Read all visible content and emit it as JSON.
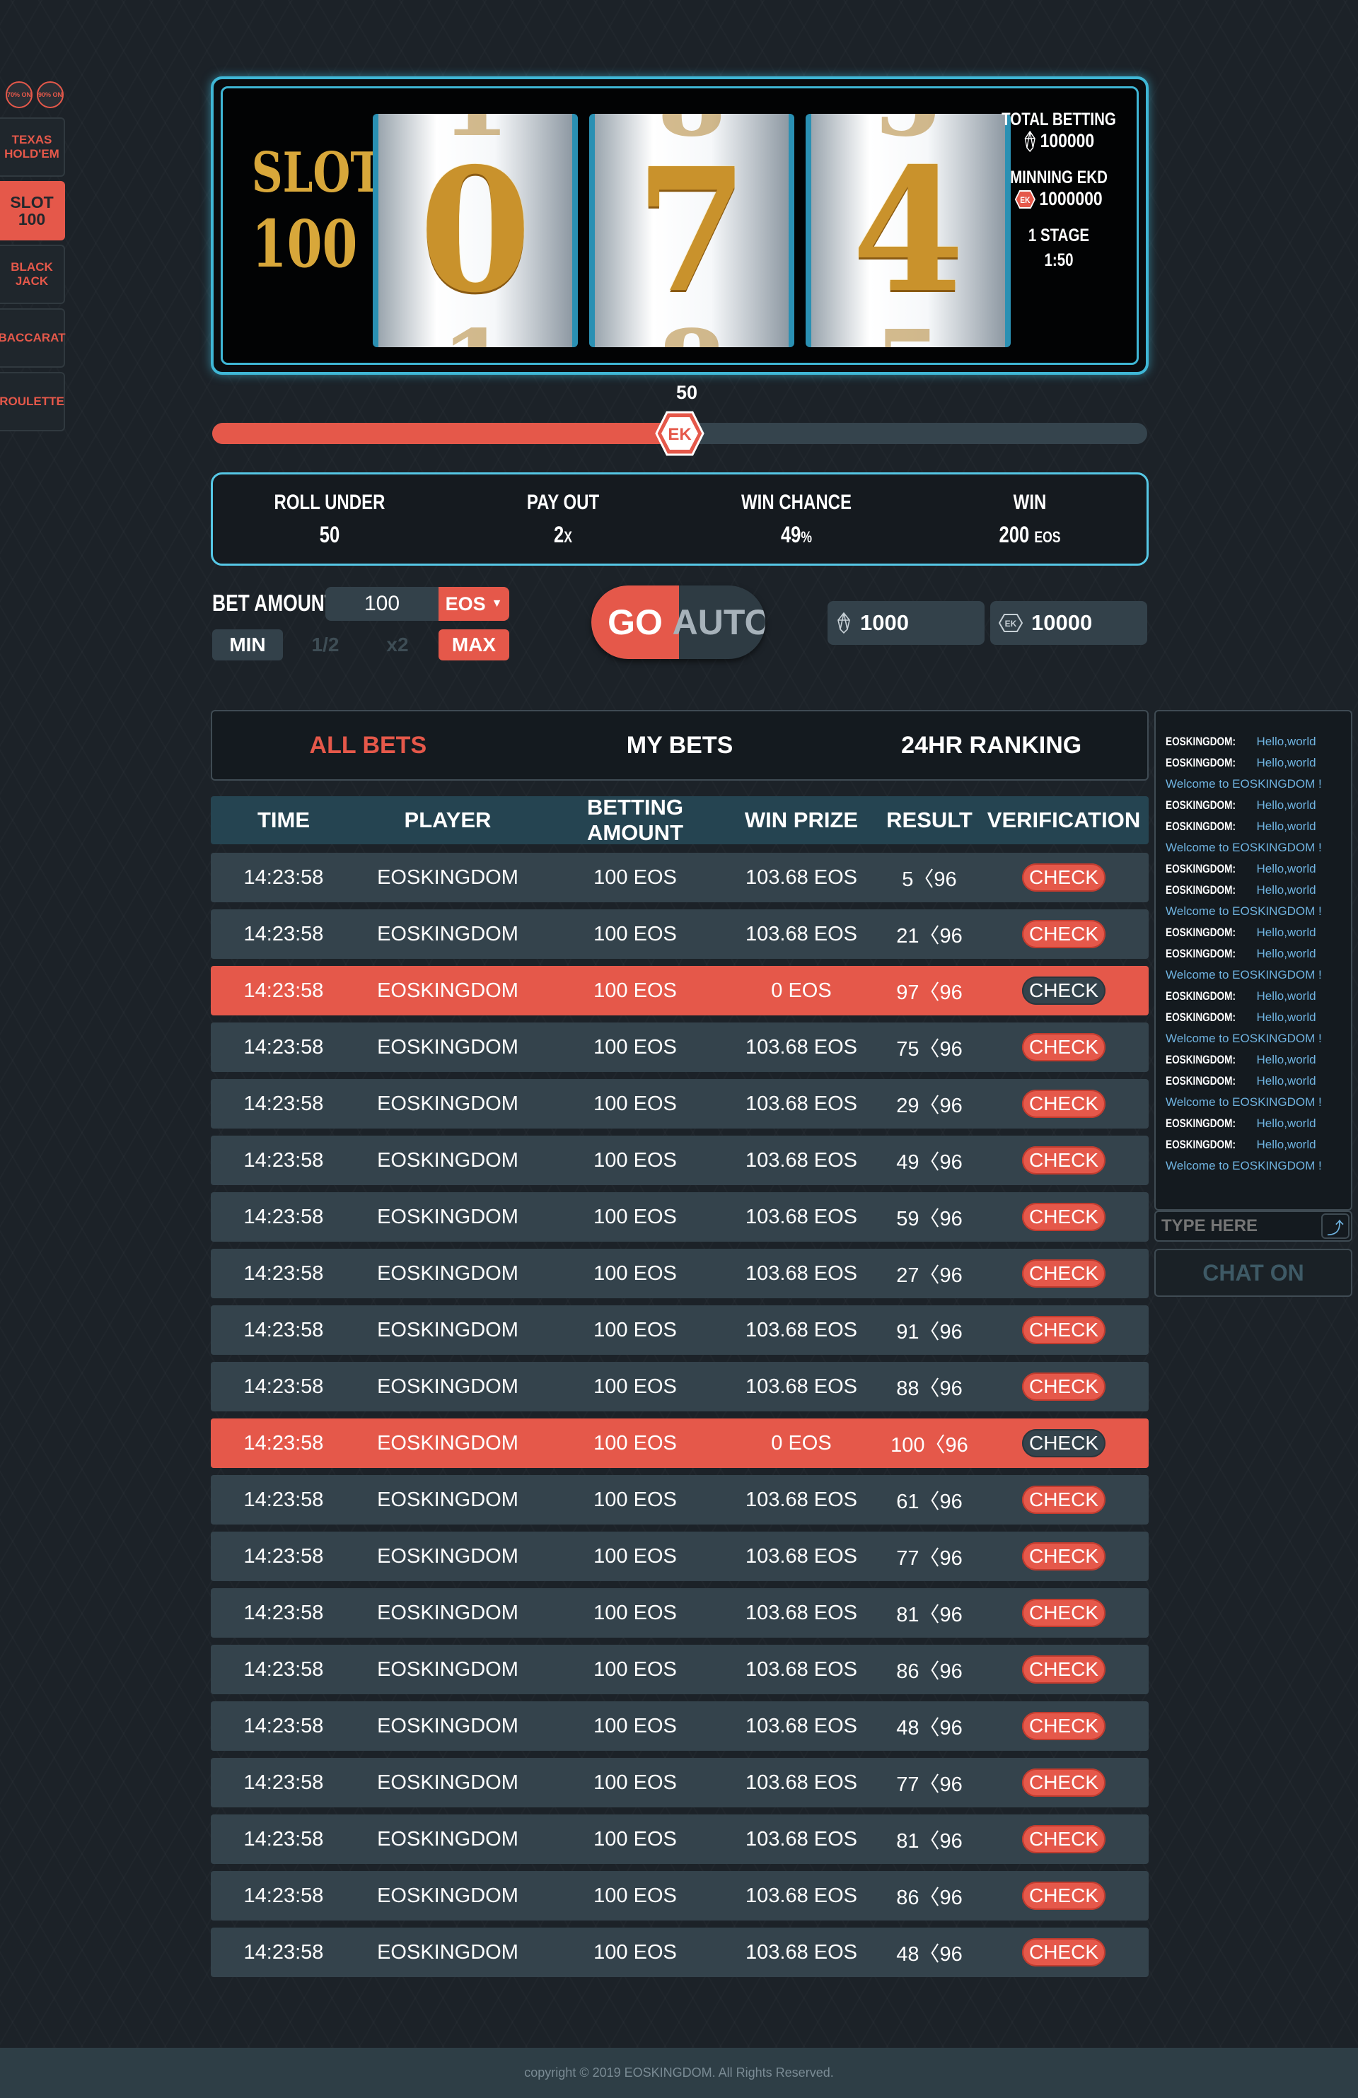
{
  "colors": {
    "accent": "#e5584a",
    "cyan": "#3fb7d6",
    "gold": "#c9922c",
    "bg": "#1c2228",
    "row": "#34434c",
    "header": "#254451"
  },
  "sidebar": {
    "toggles": [
      "70% ON",
      "90% ON"
    ],
    "items": [
      {
        "label": "TEXAS HOLD'EM",
        "active": false
      },
      {
        "label": "SLOT 100",
        "active": true
      },
      {
        "label": "BLACK JACK",
        "active": false
      },
      {
        "label": "BACCARAT",
        "active": false
      },
      {
        "label": "ROULETTE",
        "active": false
      }
    ]
  },
  "slot": {
    "title_line1": "SLOT",
    "title_line2": "100",
    "reels": [
      {
        "digit": "0",
        "above": "1",
        "below": "1"
      },
      {
        "digit": "7",
        "above": "8",
        "below": "8"
      },
      {
        "digit": "4",
        "above": "5",
        "below": "5"
      }
    ],
    "total_betting_label": "TOTAL BETTING",
    "total_betting_value": "100000",
    "mining_label": "MINNING EKD",
    "mining_value": "1000000",
    "stage_label": "1 STAGE",
    "stage_time": "1:50"
  },
  "slider": {
    "value": "50",
    "fraction": 0.5
  },
  "stats": {
    "roll_under_label": "ROLL UNDER",
    "roll_under_value": "50",
    "payout_label": "PAY OUT",
    "payout_value": "2",
    "payout_unit": "X",
    "win_chance_label": "WIN CHANCE",
    "win_chance_value": "49",
    "win_chance_unit": "%",
    "win_label": "WIN",
    "win_value": "200",
    "win_unit": "EOS"
  },
  "bet": {
    "label": "BET AMOUNT",
    "amount": "100",
    "currency": "EOS",
    "min": "MIN",
    "half": "1/2",
    "double": "x2",
    "max": "MAX",
    "go": "GO",
    "auto": "AUTO",
    "eos_balance": "1000",
    "ekd_balance": "10000"
  },
  "tabs": {
    "all_bets": "ALL BETS",
    "my_bets": "MY BETS",
    "ranking": "24HR RANKING"
  },
  "table": {
    "headers": [
      "TIME",
      "PLAYER",
      "BETTING AMOUNT",
      "WIN PRIZE",
      "RESULT",
      "VERIFICATION"
    ],
    "rows": [
      {
        "time": "14:23:58",
        "player": "EOSKINGDOM",
        "amount": "100 EOS",
        "prize": "103.68 EOS",
        "result": "5〈96",
        "verify": "CHECK",
        "lost": false
      },
      {
        "time": "14:23:58",
        "player": "EOSKINGDOM",
        "amount": "100 EOS",
        "prize": "103.68 EOS",
        "result": "21〈96",
        "verify": "CHECK",
        "lost": false
      },
      {
        "time": "14:23:58",
        "player": "EOSKINGDOM",
        "amount": "100 EOS",
        "prize": "0 EOS",
        "result": "97〈96",
        "verify": "CHECK",
        "lost": true
      },
      {
        "time": "14:23:58",
        "player": "EOSKINGDOM",
        "amount": "100 EOS",
        "prize": "103.68 EOS",
        "result": "75〈96",
        "verify": "CHECK",
        "lost": false
      },
      {
        "time": "14:23:58",
        "player": "EOSKINGDOM",
        "amount": "100 EOS",
        "prize": "103.68 EOS",
        "result": "29〈96",
        "verify": "CHECK",
        "lost": false
      },
      {
        "time": "14:23:58",
        "player": "EOSKINGDOM",
        "amount": "100 EOS",
        "prize": "103.68 EOS",
        "result": "49〈96",
        "verify": "CHECK",
        "lost": false
      },
      {
        "time": "14:23:58",
        "player": "EOSKINGDOM",
        "amount": "100 EOS",
        "prize": "103.68 EOS",
        "result": "59〈96",
        "verify": "CHECK",
        "lost": false
      },
      {
        "time": "14:23:58",
        "player": "EOSKINGDOM",
        "amount": "100 EOS",
        "prize": "103.68 EOS",
        "result": "27〈96",
        "verify": "CHECK",
        "lost": false
      },
      {
        "time": "14:23:58",
        "player": "EOSKINGDOM",
        "amount": "100 EOS",
        "prize": "103.68 EOS",
        "result": "91〈96",
        "verify": "CHECK",
        "lost": false
      },
      {
        "time": "14:23:58",
        "player": "EOSKINGDOM",
        "amount": "100 EOS",
        "prize": "103.68 EOS",
        "result": "88〈96",
        "verify": "CHECK",
        "lost": false
      },
      {
        "time": "14:23:58",
        "player": "EOSKINGDOM",
        "amount": "100 EOS",
        "prize": "0 EOS",
        "result": "100〈96",
        "verify": "CHECK",
        "lost": true
      },
      {
        "time": "14:23:58",
        "player": "EOSKINGDOM",
        "amount": "100 EOS",
        "prize": "103.68 EOS",
        "result": "61〈96",
        "verify": "CHECK",
        "lost": false
      },
      {
        "time": "14:23:58",
        "player": "EOSKINGDOM",
        "amount": "100 EOS",
        "prize": "103.68 EOS",
        "result": "77〈96",
        "verify": "CHECK",
        "lost": false
      },
      {
        "time": "14:23:58",
        "player": "EOSKINGDOM",
        "amount": "100 EOS",
        "prize": "103.68 EOS",
        "result": "81〈96",
        "verify": "CHECK",
        "lost": false
      },
      {
        "time": "14:23:58",
        "player": "EOSKINGDOM",
        "amount": "100 EOS",
        "prize": "103.68 EOS",
        "result": "86〈96",
        "verify": "CHECK",
        "lost": false
      },
      {
        "time": "14:23:58",
        "player": "EOSKINGDOM",
        "amount": "100 EOS",
        "prize": "103.68 EOS",
        "result": "48〈96",
        "verify": "CHECK",
        "lost": false
      },
      {
        "time": "14:23:58",
        "player": "EOSKINGDOM",
        "amount": "100 EOS",
        "prize": "103.68 EOS",
        "result": "77〈96",
        "verify": "CHECK",
        "lost": false
      },
      {
        "time": "14:23:58",
        "player": "EOSKINGDOM",
        "amount": "100 EOS",
        "prize": "103.68 EOS",
        "result": "81〈96",
        "verify": "CHECK",
        "lost": false
      },
      {
        "time": "14:23:58",
        "player": "EOSKINGDOM",
        "amount": "100 EOS",
        "prize": "103.68 EOS",
        "result": "86〈96",
        "verify": "CHECK",
        "lost": false
      },
      {
        "time": "14:23:58",
        "player": "EOSKINGDOM",
        "amount": "100 EOS",
        "prize": "103.68 EOS",
        "result": "48〈96",
        "verify": "CHECK",
        "lost": false
      }
    ]
  },
  "chat": {
    "messages": [
      {
        "user": "EOSKINGDOM:",
        "text": "Hello,world"
      },
      {
        "user": "EOSKINGDOM:",
        "text": "Hello,world Welcome to EOSKINGDOM !"
      },
      {
        "user": "EOSKINGDOM:",
        "text": "Hello,world"
      },
      {
        "user": "EOSKINGDOM:",
        "text": "Hello,world Welcome to EOSKINGDOM !"
      },
      {
        "user": "EOSKINGDOM:",
        "text": "Hello,world"
      },
      {
        "user": "EOSKINGDOM:",
        "text": "Hello,world Welcome to EOSKINGDOM !"
      },
      {
        "user": "EOSKINGDOM:",
        "text": "Hello,world"
      },
      {
        "user": "EOSKINGDOM:",
        "text": "Hello,world Welcome to EOSKINGDOM !"
      },
      {
        "user": "EOSKINGDOM:",
        "text": "Hello,world"
      },
      {
        "user": "EOSKINGDOM:",
        "text": "Hello,world Welcome to EOSKINGDOM !"
      },
      {
        "user": "EOSKINGDOM:",
        "text": "Hello,world"
      },
      {
        "user": "EOSKINGDOM:",
        "text": "Hello,world Welcome to EOSKINGDOM !"
      },
      {
        "user": "EOSKINGDOM:",
        "text": "Hello,world"
      },
      {
        "user": "EOSKINGDOM:",
        "text": "Hello,world Welcome to EOSKINGDOM !"
      }
    ],
    "input_placeholder": "TYPE HERE",
    "chat_on": "CHAT ON"
  },
  "footer": {
    "copyright": "copyright © 2019 EOSKINGDOM. All Rights Reserved."
  }
}
